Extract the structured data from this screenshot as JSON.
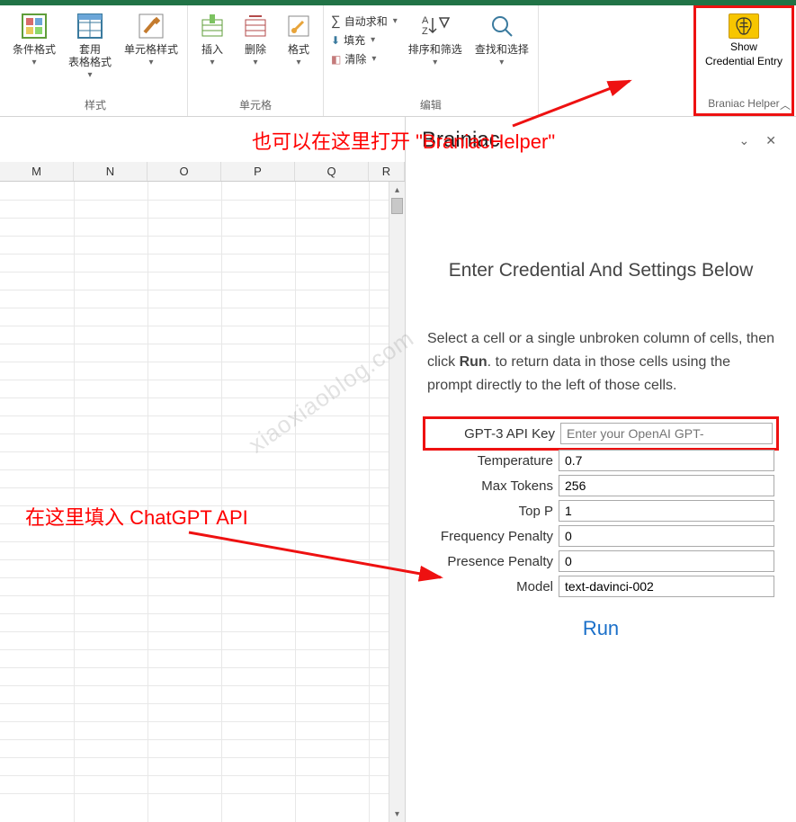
{
  "ribbon": {
    "groups": {
      "styles": {
        "label": "样式",
        "cond_format": "条件格式",
        "table_styles": "套用\n表格格式",
        "cell_styles": "单元格样式"
      },
      "cells": {
        "label": "单元格",
        "insert": "插入",
        "delete": "删除",
        "format": "格式"
      },
      "editing": {
        "label": "编辑",
        "autosum": "自动求和",
        "fill": "填充",
        "clear": "清除",
        "sort_filter": "排序和筛选",
        "find_select": "查找和选择"
      },
      "braniac": {
        "label": "Braniac Helper",
        "btn_line1": "Show",
        "btn_line2": "Credential Entry"
      }
    },
    "collapse": "︿"
  },
  "annotations": {
    "top": "也可以在这里打开 \"BraniacHelper\"",
    "left": "在这里填入 ChatGPT API"
  },
  "watermark": "xiaoxiaoblog.com",
  "sheet": {
    "cols": [
      "M",
      "N",
      "O",
      "P",
      "Q",
      "R"
    ]
  },
  "pane": {
    "title": "Brainiac",
    "heading": "Enter Credential And Settings Below",
    "instructions_pre": "Select a cell or a single unbroken column of cells, then click ",
    "instructions_bold": "Run",
    "instructions_post": ". to return data in those cells using the prompt directly to the left of those cells.",
    "form": {
      "api_key_label": "GPT-3 API Key",
      "api_key_placeholder": "Enter your OpenAI GPT-",
      "temperature_label": "Temperature",
      "temperature_value": "0.7",
      "max_tokens_label": "Max Tokens",
      "max_tokens_value": "256",
      "top_p_label": "Top P",
      "top_p_value": "1",
      "freq_penalty_label": "Frequency Penalty",
      "freq_penalty_value": "0",
      "pres_penalty_label": "Presence Penalty",
      "pres_penalty_value": "0",
      "model_label": "Model",
      "model_value": "text-davinci-002"
    },
    "run": "Run"
  }
}
